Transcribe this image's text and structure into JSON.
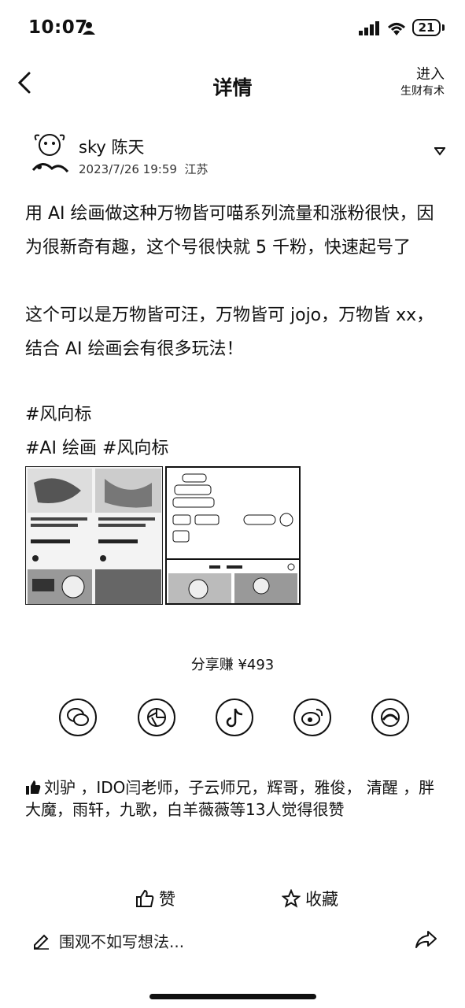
{
  "status_bar": {
    "time": "10:07",
    "battery": "21"
  },
  "nav": {
    "title": "详情",
    "enter_label": "进入",
    "enter_sub": "生财有术"
  },
  "author": {
    "name": "sky 陈天",
    "date": "2023/7/26 19:59",
    "location": "江苏"
  },
  "post": {
    "text": "用 AI 绘画做这种万物皆可喵系列流量和涨粉很快，因为很新奇有趣，这个号很快就 5 千粉，快速起号了\n\n这个可以是万物皆可汪，万物皆可 jojo，万物皆 xx，结合 AI 绘画会有很多玩法！",
    "tag_line_1": "#风向标",
    "tag_line_2": "#AI 绘画 #风向标"
  },
  "share_earn": "分享赚 ¥493",
  "share_icons": [
    "wechat-icon",
    "moments-icon",
    "douyin-icon",
    "weibo-icon",
    "camera-lens-icon"
  ],
  "likes_text": "刘驴 ，IDO闫老师，子云师兄，辉哥，雅俊， 清醒 ，胖大魔，雨轩，九歌，白羊薇薇等13人觉得很赞",
  "actions": {
    "like_label": "赞",
    "favorite_label": "收藏"
  },
  "comment_placeholder": "围观不如写想法...",
  "colors": {
    "text": "#111111",
    "background": "#ffffff"
  }
}
